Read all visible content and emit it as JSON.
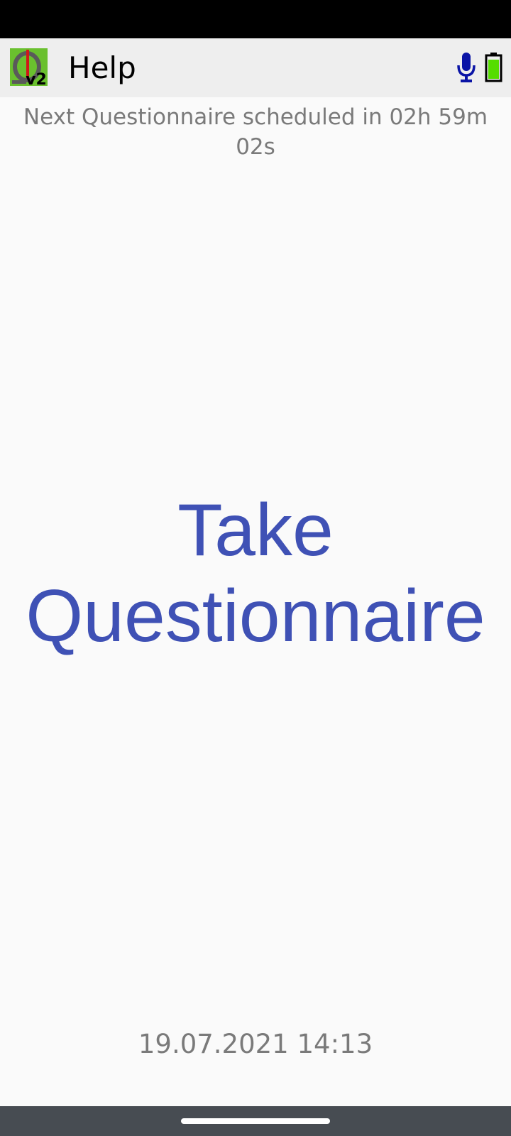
{
  "app_bar": {
    "title": "Help",
    "logo_icon": "app-logo-v2-icon",
    "logo_text": "v2",
    "logo_bg_color": "#6ac02e",
    "mic_icon": "microphone-icon",
    "mic_color": "#0a14a6",
    "battery_icon": "battery-icon",
    "battery_color": "#55dd00"
  },
  "schedule": {
    "text": "Next Questionnaire scheduled in 02h 59m 02s"
  },
  "main": {
    "button_line1": "Take",
    "button_line2": "Questionnaire",
    "button_color": "#3f51b5"
  },
  "footer": {
    "datetime": "19.07.2021 14:13"
  }
}
